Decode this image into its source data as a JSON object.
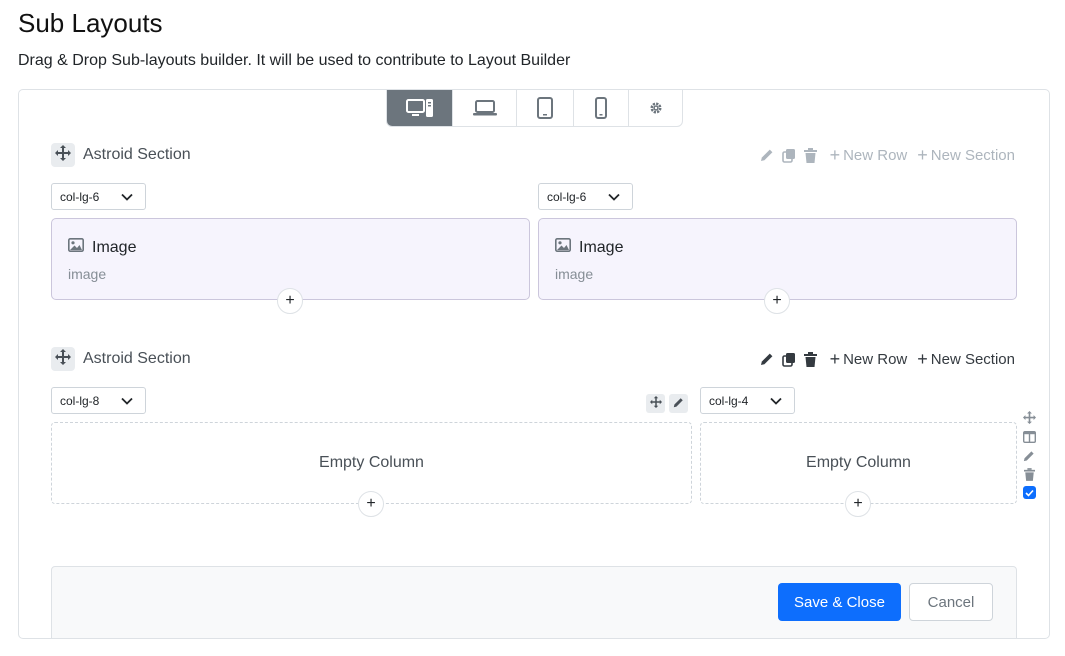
{
  "page": {
    "title": "Sub Layouts",
    "description": "Drag & Drop Sub-layouts builder. It will be used to contribute to Layout Builder"
  },
  "device_bar": {
    "items": [
      {
        "icon": "desktop-icon",
        "active": true
      },
      {
        "icon": "laptop-icon",
        "active": false
      },
      {
        "icon": "tablet-icon",
        "active": false
      },
      {
        "icon": "mobile-icon",
        "active": false
      },
      {
        "icon": "gear-icon",
        "active": false
      }
    ]
  },
  "sections": [
    {
      "title": "Astroid Section",
      "new_row_label": "New Row",
      "new_section_label": "New Section",
      "columns": [
        {
          "size": "col-lg-6",
          "element": {
            "title": "Image",
            "subtitle": "image",
            "icon": "image-icon"
          }
        },
        {
          "size": "col-lg-6",
          "element": {
            "title": "Image",
            "subtitle": "image",
            "icon": "image-icon"
          }
        }
      ]
    },
    {
      "title": "Astroid Section",
      "new_row_label": "New Row",
      "new_section_label": "New Section",
      "columns": [
        {
          "size": "col-lg-8",
          "empty_label": "Empty Column"
        },
        {
          "size": "col-lg-4",
          "empty_label": "Empty Column"
        }
      ]
    }
  ],
  "colors": {
    "primary": "#0d6efd",
    "device_active": "#6c757d",
    "addon_bg": "#f6f4fd"
  },
  "footer": {
    "save_label": "Save & Close",
    "cancel_label": "Cancel"
  }
}
